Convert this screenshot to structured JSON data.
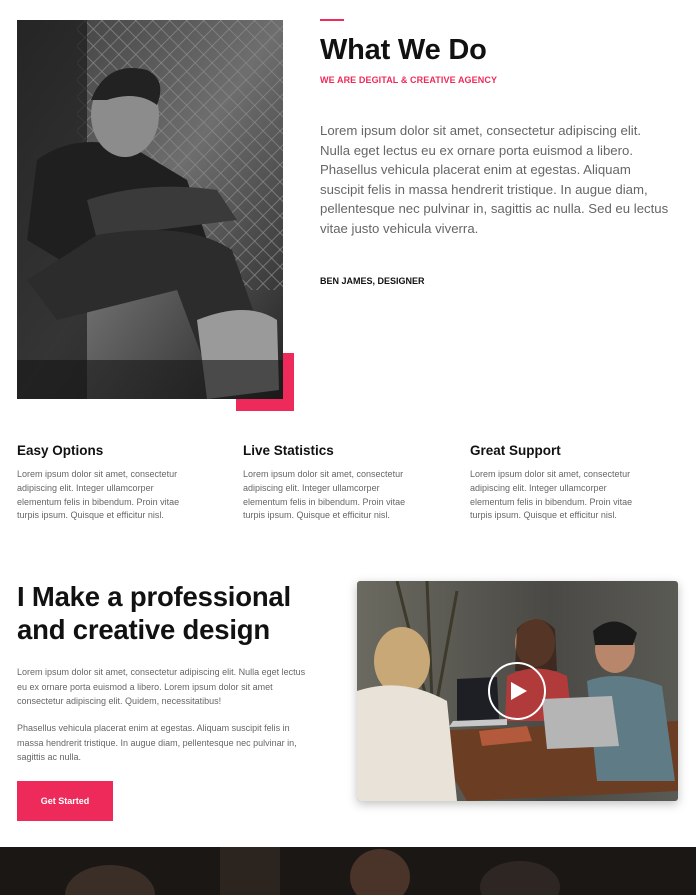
{
  "about": {
    "title": "What We Do",
    "subtitle": "WE ARE DEGITAL & CREATIVE AGENCY",
    "body": "Lorem ipsum dolor sit amet, consectetur adipiscing elit. Nulla eget lectus eu ex ornare porta euismod a libero. Phasellus vehicula placerat enim at egestas. Aliquam suscipit felis in massa hendrerit tristique. In augue diam, pellentesque nec pulvinar in, sagittis ac nulla. Sed eu lectus vitae justo vehicula viverra.",
    "author": "BEN JAMES, DESIGNER"
  },
  "features": [
    {
      "title": "Easy Options",
      "text": "Lorem ipsum dolor sit amet, consectetur adipiscing elit. Integer ullamcorper elementum felis in bibendum. Proin vitae turpis ipsum. Quisque et efficitur nisl."
    },
    {
      "title": "Live Statistics",
      "text": "Lorem ipsum dolor sit amet, consectetur adipiscing elit. Integer ullamcorper elementum felis in bibendum. Proin vitae turpis ipsum. Quisque et efficitur nisl."
    },
    {
      "title": "Great Support",
      "text": "Lorem ipsum dolor sit amet, consectetur adipiscing elit. Integer ullamcorper elementum felis in bibendum. Proin vitae turpis ipsum. Quisque et efficitur nisl."
    }
  ],
  "pro": {
    "title": "I Make a professional and creative design",
    "p1": "Lorem ipsum dolor sit amet, consectetur adipiscing elit. Nulla eget lectus eu ex ornare porta euismod a libero. Lorem ipsum dolor sit amet consectetur adipiscing elit. Quidem, necessitatibus!",
    "p2": "Phasellus vehicula placerat enim at egestas. Aliquam suscipit felis in massa hendrerit tristique. In augue diam, pellentesque nec pulvinar in, sagittis ac nulla.",
    "cta_label": "Get Started"
  },
  "icons": {
    "video": "play-icon"
  },
  "colors": {
    "accent": "#ee2a5a",
    "heading": "#111111",
    "body_text": "#666666"
  }
}
